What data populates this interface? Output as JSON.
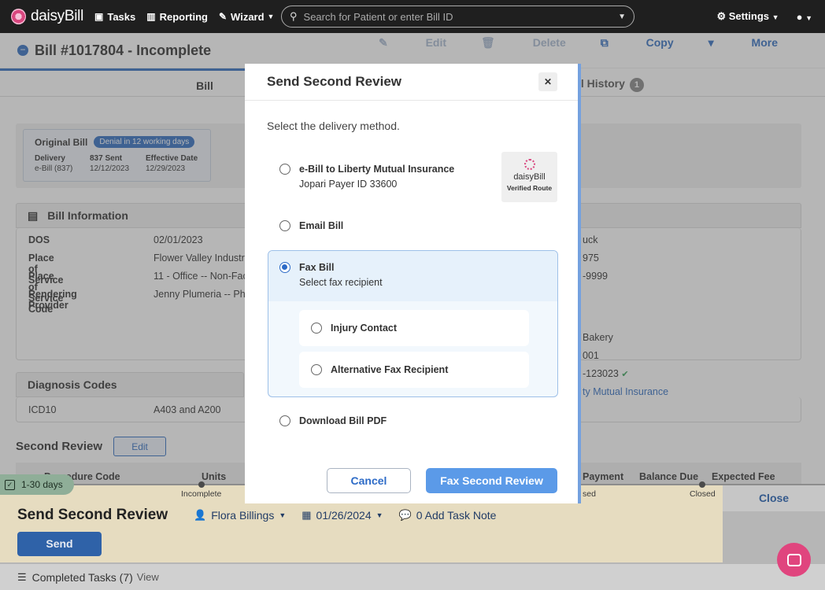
{
  "topnav": {
    "brand": "daisyBill",
    "tasks": "Tasks",
    "reporting": "Reporting",
    "wizard": "Wizard",
    "search_placeholder": "Search for Patient or enter Bill ID",
    "settings": "Settings"
  },
  "page": {
    "title": "Bill #1017804 - Incomplete",
    "actions": {
      "edit": "Edit",
      "delete": "Delete",
      "copy": "Copy",
      "more": "More"
    },
    "tabs": {
      "bill": "Bill",
      "history": "Bill History",
      "history_count": "1"
    },
    "original_bill": {
      "label": "Original Bill",
      "badge": "Denial in 12 working days",
      "delivery_label": "Delivery",
      "delivery_value": "e-Bill (837)",
      "sent_label": "837 Sent",
      "sent_value": "12/12/2023",
      "effective_label": "Effective Date",
      "effective_value": "12/29/2023"
    },
    "bill_info": {
      "heading": "Bill Information",
      "rows": [
        {
          "k": "DOS",
          "v": "02/01/2023"
        },
        {
          "k": "Place of Service",
          "v": "Flower Valley Industr"
        },
        {
          "k": "Place of Service Code",
          "v": "11 - Office -- Non-Faci"
        },
        {
          "k": "Rendering Provider",
          "v": "Jenny Plumeria -- Phy"
        }
      ],
      "right": [
        "uck",
        "975",
        "-9999"
      ]
    },
    "right_panel": {
      "lines": [
        "Bakery",
        "001",
        "-123023"
      ],
      "link": "ty Mutual Insurance"
    },
    "diagnosis": {
      "heading": "Diagnosis Codes",
      "k": "ICD10",
      "v": "A403 and A200"
    },
    "second_review": {
      "label": "Second Review",
      "edit": "Edit"
    },
    "table_headers": {
      "procedure": "Procedure Code",
      "units": "Units",
      "payment": "Payment",
      "balance": "Balance Due",
      "expected": "Expected Fee"
    }
  },
  "task": {
    "days": "1-30 days",
    "timeline_incomplete": "Incomplete",
    "timeline_sed": "sed",
    "timeline_closed": "Closed",
    "close": "Close",
    "title": "Send Second Review",
    "assignee": "Flora Billings",
    "date": "01/26/2024",
    "note": "0 Add Task Note",
    "send": "Send",
    "completed": "Completed Tasks (7)",
    "view": "View"
  },
  "modal": {
    "title": "Send Second Review",
    "subtitle": "Select the delivery method.",
    "options": {
      "ebill_title": "e-Bill to Liberty Mutual Insurance",
      "ebill_sub": "Jopari Payer ID 33600",
      "verified_name": "daisyBill",
      "verified_route": "Verified Route",
      "email": "Email Bill",
      "fax_title": "Fax Bill",
      "fax_sub": "Select fax recipient",
      "fax_injury": "Injury Contact",
      "fax_alt": "Alternative Fax Recipient",
      "download": "Download Bill PDF"
    },
    "cancel": "Cancel",
    "submit": "Fax Second Review"
  }
}
